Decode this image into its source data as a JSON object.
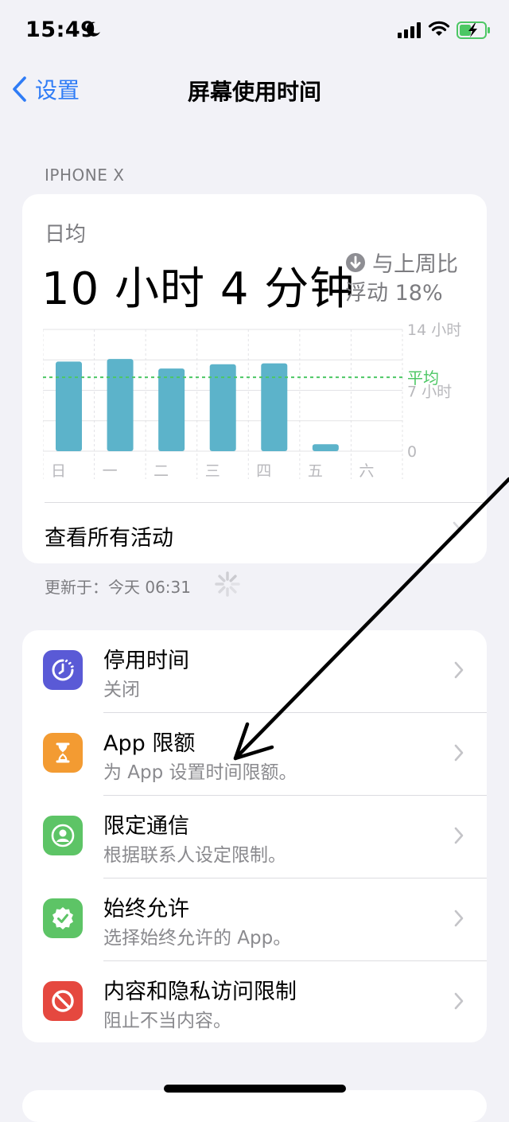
{
  "status": {
    "time": "15:49"
  },
  "nav": {
    "back_label": "设置",
    "title": "屏幕使用时间"
  },
  "section_label": "IPHONE X",
  "summary": {
    "avg_label": "日均",
    "value": "10 小时 4 分钟",
    "compare_label": "与上周比",
    "compare_value": "浮动 18%"
  },
  "chart_data": {
    "type": "bar",
    "categories": [
      "日",
      "一",
      "二",
      "三",
      "四",
      "五",
      "六"
    ],
    "values": [
      10.3,
      10.6,
      9.5,
      10.0,
      10.1,
      0.8,
      0
    ],
    "y_ticks": [
      "14 小时",
      "7 小时",
      "0"
    ],
    "ylim": [
      0,
      14
    ],
    "average": 8.5,
    "average_label": "平均",
    "bar_color": "#5cb3ca",
    "average_color": "#4cc764"
  },
  "see_all_label": "查看所有活动",
  "updated_text": "更新于：今天 06:31",
  "settings": [
    {
      "title": "停用时间",
      "subtitle": "关闭",
      "icon": "downtime-icon",
      "color": "#5a5ad6"
    },
    {
      "title": "App 限额",
      "subtitle": "为 App 设置时间限额。",
      "icon": "hourglass-icon",
      "color": "#f39b32"
    },
    {
      "title": "限定通信",
      "subtitle": "根据联系人设定限制。",
      "icon": "contact-icon",
      "color": "#5dc466"
    },
    {
      "title": "始终允许",
      "subtitle": "选择始终允许的 App。",
      "icon": "checkmark-badge-icon",
      "color": "#5dc466"
    },
    {
      "title": "内容和隐私访问限制",
      "subtitle": "阻止不当内容。",
      "icon": "restriction-icon",
      "color": "#e5483f"
    }
  ]
}
